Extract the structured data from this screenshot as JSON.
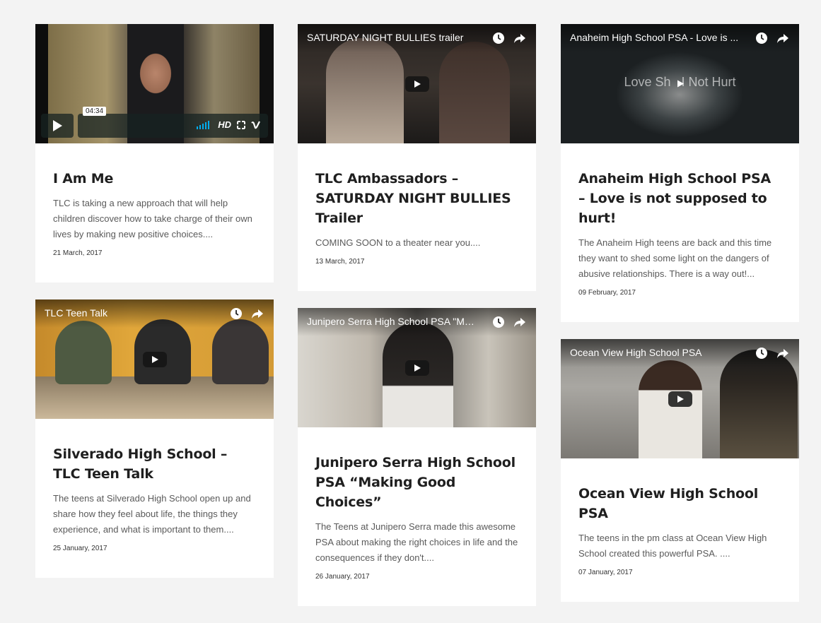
{
  "cards": [
    {
      "title": "I Am Me",
      "excerpt": "TLC is taking a new approach that will help children discover how to take charge of their own lives by making new positive choices....",
      "date": "21 March, 2017",
      "video": {
        "provider": "vimeo",
        "time": "04:34",
        "hd_label": "HD"
      }
    },
    {
      "title": "TLC Ambassadors – SATURDAY NIGHT BULLIES Trailer",
      "excerpt": "COMING SOON to a theater near you....",
      "date": "13 March, 2017",
      "video": {
        "provider": "youtube",
        "title": "SATURDAY NIGHT BULLIES trailer"
      }
    },
    {
      "title": "Anaheim High School PSA – Love is not supposed to hurt!",
      "excerpt": "The Anaheim High teens are back and this time they want to shed some light on the dangers of abusive relationships. There is a way out!...",
      "date": "09 February, 2017",
      "video": {
        "provider": "youtube",
        "title": "Anaheim High School PSA - Love is ...",
        "overlay_text": "Love Sh   I Not Hurt"
      }
    },
    {
      "title": "Silverado High School – TLC Teen Talk",
      "excerpt": "The teens at Silverado High School open up and share how they feel about life, the things they experience, and what is important to them....",
      "date": "25 January, 2017",
      "video": {
        "provider": "youtube",
        "title": "TLC Teen Talk"
      }
    },
    {
      "title": "Junipero Serra High School PSA “Making Good Choices”",
      "excerpt": "The Teens at Junipero Serra made this awesome PSA about making the right choices in life and the consequences if they don't....",
      "date": "26 January, 2017",
      "video": {
        "provider": "youtube",
        "title": "Junipero Serra High School PSA \"Ma..."
      }
    },
    {
      "title": "Ocean View High School PSA",
      "excerpt": "The teens in the pm class at Ocean View High School created this powerful PSA. ....",
      "date": "07 January, 2017",
      "video": {
        "provider": "youtube",
        "title": "Ocean View High School PSA"
      }
    }
  ],
  "icons": {
    "watch_later": "clock-icon",
    "share": "share-icon",
    "play": "play-icon"
  },
  "colors": {
    "background": "#f3f3f3",
    "card": "#ffffff",
    "title": "#1f1f1f",
    "text": "#5a5a5a",
    "vimeo_accent": "#00adef"
  }
}
